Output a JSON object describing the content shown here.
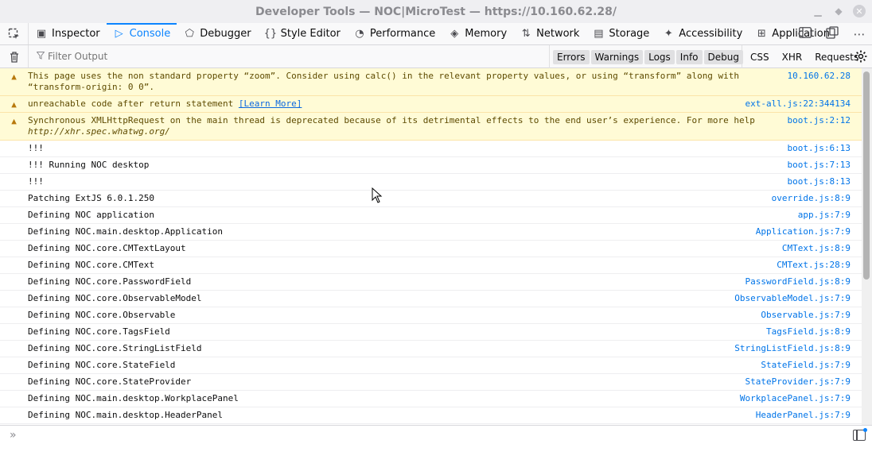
{
  "window": {
    "title": "Developer Tools — NOC|MicroTest — https://10.160.62.28/"
  },
  "toolbar": {
    "tabs": [
      {
        "label": "Inspector",
        "icon": "inspector-icon",
        "selected": false
      },
      {
        "label": "Console",
        "icon": "console-icon",
        "selected": true
      },
      {
        "label": "Debugger",
        "icon": "debugger-icon",
        "selected": false
      },
      {
        "label": "Style Editor",
        "icon": "style-editor-icon",
        "selected": false
      },
      {
        "label": "Performance",
        "icon": "performance-icon",
        "selected": false
      },
      {
        "label": "Memory",
        "icon": "memory-icon",
        "selected": false
      },
      {
        "label": "Network",
        "icon": "network-icon",
        "selected": false
      },
      {
        "label": "Storage",
        "icon": "storage-icon",
        "selected": false
      },
      {
        "label": "Accessibility",
        "icon": "accessibility-icon",
        "selected": false
      },
      {
        "label": "Application",
        "icon": "application-icon",
        "selected": false
      }
    ]
  },
  "filterbar": {
    "placeholder": "Filter Output",
    "levels": [
      "Errors",
      "Warnings",
      "Logs",
      "Info",
      "Debug"
    ],
    "categories": [
      "CSS",
      "XHR",
      "Requests"
    ]
  },
  "messages": [
    {
      "type": "warn",
      "text": "This page uses the non standard property “zoom”. Consider using calc() in the relevant property values, or using “transform” along with “transform-origin: 0 0”.",
      "source": "10.160.62.28"
    },
    {
      "type": "warn",
      "text": "unreachable code after return statement ",
      "link": "[Learn More]",
      "source": "ext-all.js:22:344134"
    },
    {
      "type": "warn",
      "text": "Synchronous XMLHttpRequest on the main thread is deprecated because of its detrimental effects to the end user’s experience. For more help ",
      "italic": "http://xhr.spec.whatwg.org/",
      "source": "boot.js:2:12"
    },
    {
      "type": "log",
      "text": "!!!",
      "source": "boot.js:6:13"
    },
    {
      "type": "log",
      "text": "!!! Running NOC desktop",
      "source": "boot.js:7:13"
    },
    {
      "type": "log",
      "text": "!!!",
      "source": "boot.js:8:13"
    },
    {
      "type": "log",
      "text": "Patching ExtJS 6.0.1.250",
      "source": "override.js:8:9"
    },
    {
      "type": "log",
      "text": "Defining NOC application",
      "source": "app.js:7:9"
    },
    {
      "type": "log",
      "text": "Defining NOC.main.desktop.Application",
      "source": "Application.js:7:9"
    },
    {
      "type": "log",
      "text": "Defining NOC.core.CMTextLayout",
      "source": "CMText.js:8:9"
    },
    {
      "type": "log",
      "text": "Defining NOC.core.CMText",
      "source": "CMText.js:28:9"
    },
    {
      "type": "log",
      "text": "Defining NOC.core.PasswordField",
      "source": "PasswordField.js:8:9"
    },
    {
      "type": "log",
      "text": "Defining NOC.core.ObservableModel",
      "source": "ObservableModel.js:7:9"
    },
    {
      "type": "log",
      "text": "Defining NOC.core.Observable",
      "source": "Observable.js:7:9"
    },
    {
      "type": "log",
      "text": "Defining NOC.core.TagsField",
      "source": "TagsField.js:8:9"
    },
    {
      "type": "log",
      "text": "Defining NOC.core.StringListField",
      "source": "StringListField.js:8:9"
    },
    {
      "type": "log",
      "text": "Defining NOC.core.StateField",
      "source": "StateField.js:7:9"
    },
    {
      "type": "log",
      "text": "Defining NOC.core.StateProvider",
      "source": "StateProvider.js:7:9"
    },
    {
      "type": "log",
      "text": "Defining NOC.main.desktop.WorkplacePanel",
      "source": "WorkplacePanel.js:7:9"
    },
    {
      "type": "log",
      "text": "Defining NOC.main.desktop.HeaderPanel",
      "source": "HeaderPanel.js:7:9"
    }
  ],
  "colors": {
    "accent": "#0a84ff",
    "warning_bg": "#fffbd6",
    "source_link": "#0074e8"
  }
}
